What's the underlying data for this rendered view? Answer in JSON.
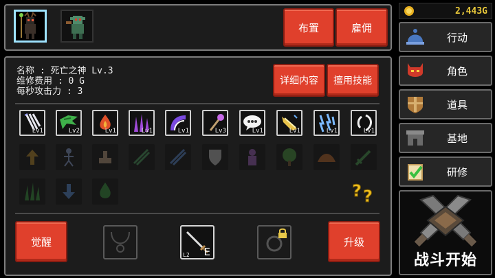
{
  "gold": "2,443G",
  "top_buttons": {
    "deploy": "布置",
    "hire": "雇佣"
  },
  "character": {
    "name_line": "名称 : 死亡之神 Lv.3",
    "upkeep_line": "维修费用 : 0 G",
    "attack_line": "每秒攻击力 : 3"
  },
  "detail_buttons": {
    "details": "详细内容",
    "use_skill": "擅用技能"
  },
  "skills_unlocked": [
    {
      "icon": "claw-slash-icon",
      "level": "Lv1"
    },
    {
      "icon": "green-dragon-icon",
      "level": "Lv2"
    },
    {
      "icon": "fire-drop-icon",
      "level": "Lv1"
    },
    {
      "icon": "purple-spikes-icon",
      "level": "Lv1"
    },
    {
      "icon": "purple-wave-icon",
      "level": "Lv1"
    },
    {
      "icon": "magic-wand-icon",
      "level": "Lv3"
    },
    {
      "icon": "speech-bubble-icon",
      "level": "Lv1"
    },
    {
      "icon": "golden-wing-icon",
      "level": "Lv1"
    },
    {
      "icon": "blue-lightning-icon",
      "level": "Lv1"
    },
    {
      "icon": "curved-blade-icon",
      "level": "Lv1"
    }
  ],
  "skills_locked": [
    "arrow-up-icon",
    "stick-figure-icon",
    "anvil-icon",
    "green-arrows-icon",
    "blue-arrows-icon",
    "shield-icon",
    "purple-figure-icon",
    "green-tree-icon",
    "brown-wave-icon",
    "green-sword-icon",
    "grass-icon",
    "arrow-down-icon",
    "green-drop-icon"
  ],
  "help_icon": "question-marks-icon",
  "bottom": {
    "awaken": "觉醒",
    "upgrade": "升级",
    "equip_level": "L2",
    "equip_tag": "E"
  },
  "menu": [
    {
      "icon": "helmet-icon",
      "label": "行动"
    },
    {
      "icon": "demon-mask-icon",
      "label": "角色"
    },
    {
      "icon": "chest-icon",
      "label": "道具"
    },
    {
      "icon": "base-icon",
      "label": "基地"
    },
    {
      "icon": "research-check-icon",
      "label": "研修"
    }
  ],
  "battle_start": "战斗开始",
  "colors": {
    "accent_red": "#e0402c",
    "gold": "#e8c83a",
    "selected_border": "#9ee3ff"
  }
}
